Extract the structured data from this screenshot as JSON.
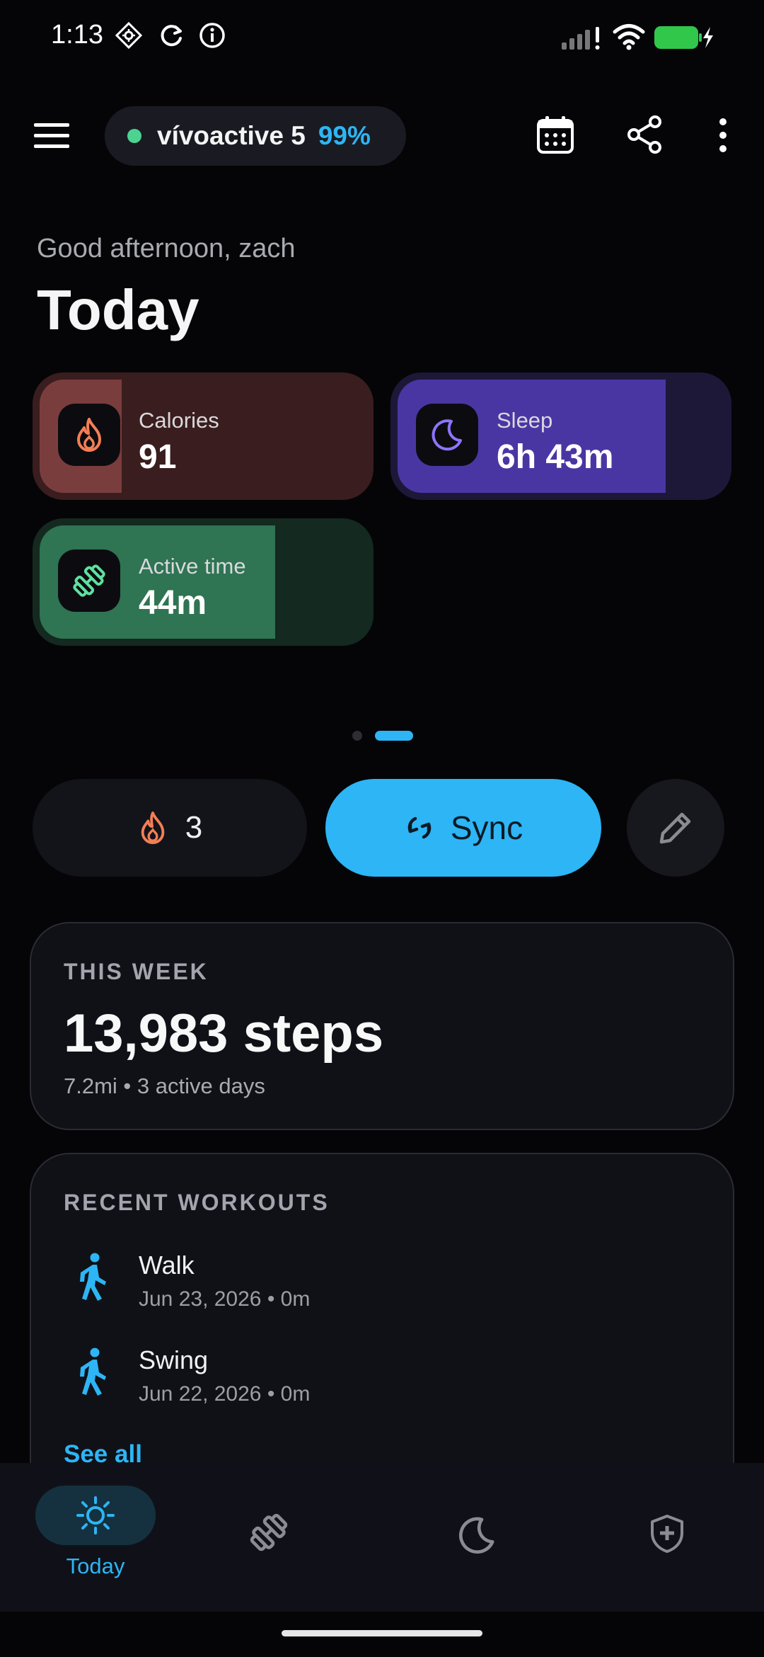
{
  "status_bar": {
    "time": "1:13",
    "left_icons": [
      "gps-target-icon",
      "sync-status-icon",
      "info-icon"
    ],
    "right_icons": [
      "signal-icon",
      "wifi-icon",
      "battery-charging-icon"
    ]
  },
  "header": {
    "menu_icon": "hamburger-menu-icon",
    "device": {
      "name": "vívoactive 5",
      "battery": "99%",
      "status_color": "#4cd391"
    },
    "actions": [
      "calendar-icon",
      "share-icon",
      "more-vertical-icon"
    ]
  },
  "greeting": "Good afternoon, zach",
  "title": "Today",
  "metrics": [
    {
      "label": "Calories",
      "value": "91",
      "icon": "flame-icon",
      "fill_color": "#7a3d3d",
      "track_color": "#3a1d1e",
      "icon_color": "#f47f55",
      "progress": 0.25
    },
    {
      "label": "Sleep",
      "value": "6h 43m",
      "icon": "moon-icon",
      "fill_color": "#4a36a3",
      "track_color": "#1d1838",
      "icon_color": "#8e74ff",
      "progress": 0.82
    },
    {
      "label": "Active time",
      "value": "44m",
      "icon": "dumbbell-icon",
      "fill_color": "#2f7453",
      "track_color": "#14291f",
      "icon_color": "#5fe0a0",
      "progress": 0.72
    }
  ],
  "pager": {
    "pages": 2,
    "active": 1
  },
  "actions": {
    "streak": {
      "icon": "flame-icon",
      "count": "3"
    },
    "sync": {
      "icon": "sync-icon",
      "label": "Sync"
    },
    "edit": {
      "icon": "pencil-icon"
    }
  },
  "this_week": {
    "heading": "THIS WEEK",
    "steps": "13,983 steps",
    "summary": "7.2mi • 3 active days"
  },
  "recent_workouts": {
    "heading": "RECENT WORKOUTS",
    "items": [
      {
        "name": "Walk",
        "detail": "Jun 23, 2026 • 0m",
        "icon": "walking-icon"
      },
      {
        "name": "Swing",
        "detail": "Jun 22, 2026 • 0m",
        "icon": "walking-icon"
      }
    ],
    "see_all": "See all"
  },
  "bottom_nav": {
    "active": 0,
    "items": [
      {
        "label": "Today",
        "icon": "sun-icon"
      },
      {
        "label": "",
        "icon": "dumbbell-icon"
      },
      {
        "label": "",
        "icon": "moon-icon"
      },
      {
        "label": "",
        "icon": "shield-plus-icon"
      }
    ]
  },
  "colors": {
    "accent": "#2db5f5",
    "flame": "#f47f55",
    "background": "#050508"
  }
}
